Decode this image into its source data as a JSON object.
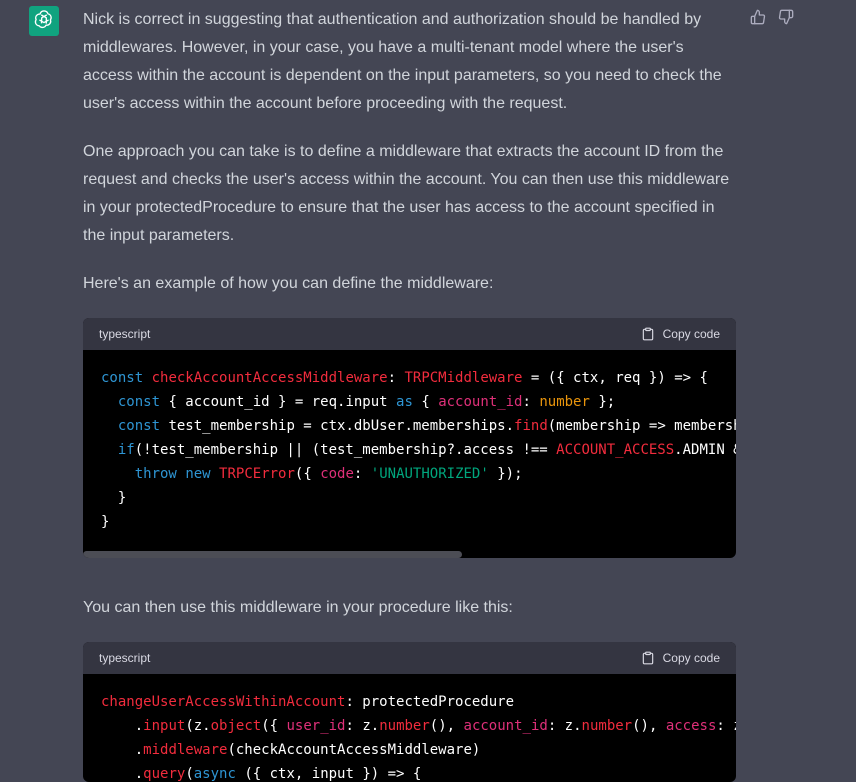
{
  "message": {
    "paragraphs": [
      "Nick is correct in suggesting that authentication and authorization should be handled by middlewares. However, in your case, you have a multi-tenant model where the user's access within the account is dependent on the input parameters, so you need to check the user's access within the account before proceeding with the request.",
      "One approach you can take is to define a middleware that extracts the account ID from the request and checks the user's access within the account. You can then use this middleware in your protectedProcedure to ensure that the user has access to the account specified in the input parameters.",
      "Here's an example of how you can define the middleware:",
      "You can then use this middleware in your procedure like this:"
    ]
  },
  "code_blocks": [
    {
      "language": "typescript",
      "copy_label": "Copy code",
      "lines": [
        "const checkAccountAccessMiddleware: TRPCMiddleware = ({ ctx, req }) => {",
        "  const { account_id } = req.input as { account_id: number };",
        "  const test_membership = ctx.dbUser.memberships.find(membership => membersh",
        "  if(!test_membership || (test_membership?.access !== ACCOUNT_ACCESS.ADMIN &",
        "    throw new TRPCError({ code: 'UNAUTHORIZED' });",
        "  }",
        "}"
      ]
    },
    {
      "language": "typescript",
      "copy_label": "Copy code",
      "lines": [
        "changeUserAccessWithinAccount: protectedProcedure",
        "    .input(z.object({ user_id: z.number(), account_id: z.number(), access: z",
        "    .middleware(checkAccountAccessMiddleware)",
        "    .query(async ({ ctx, input }) => {"
      ]
    }
  ],
  "icons": {
    "avatar": "openai-logo-icon",
    "thumbs_up": "thumbs-up-icon",
    "thumbs_down": "thumbs-down-icon",
    "copy": "clipboard-icon"
  },
  "colors": {
    "background": "#444654",
    "avatar_bg": "#10a37f",
    "code_bg": "#000000",
    "code_header_bg": "#343541"
  }
}
